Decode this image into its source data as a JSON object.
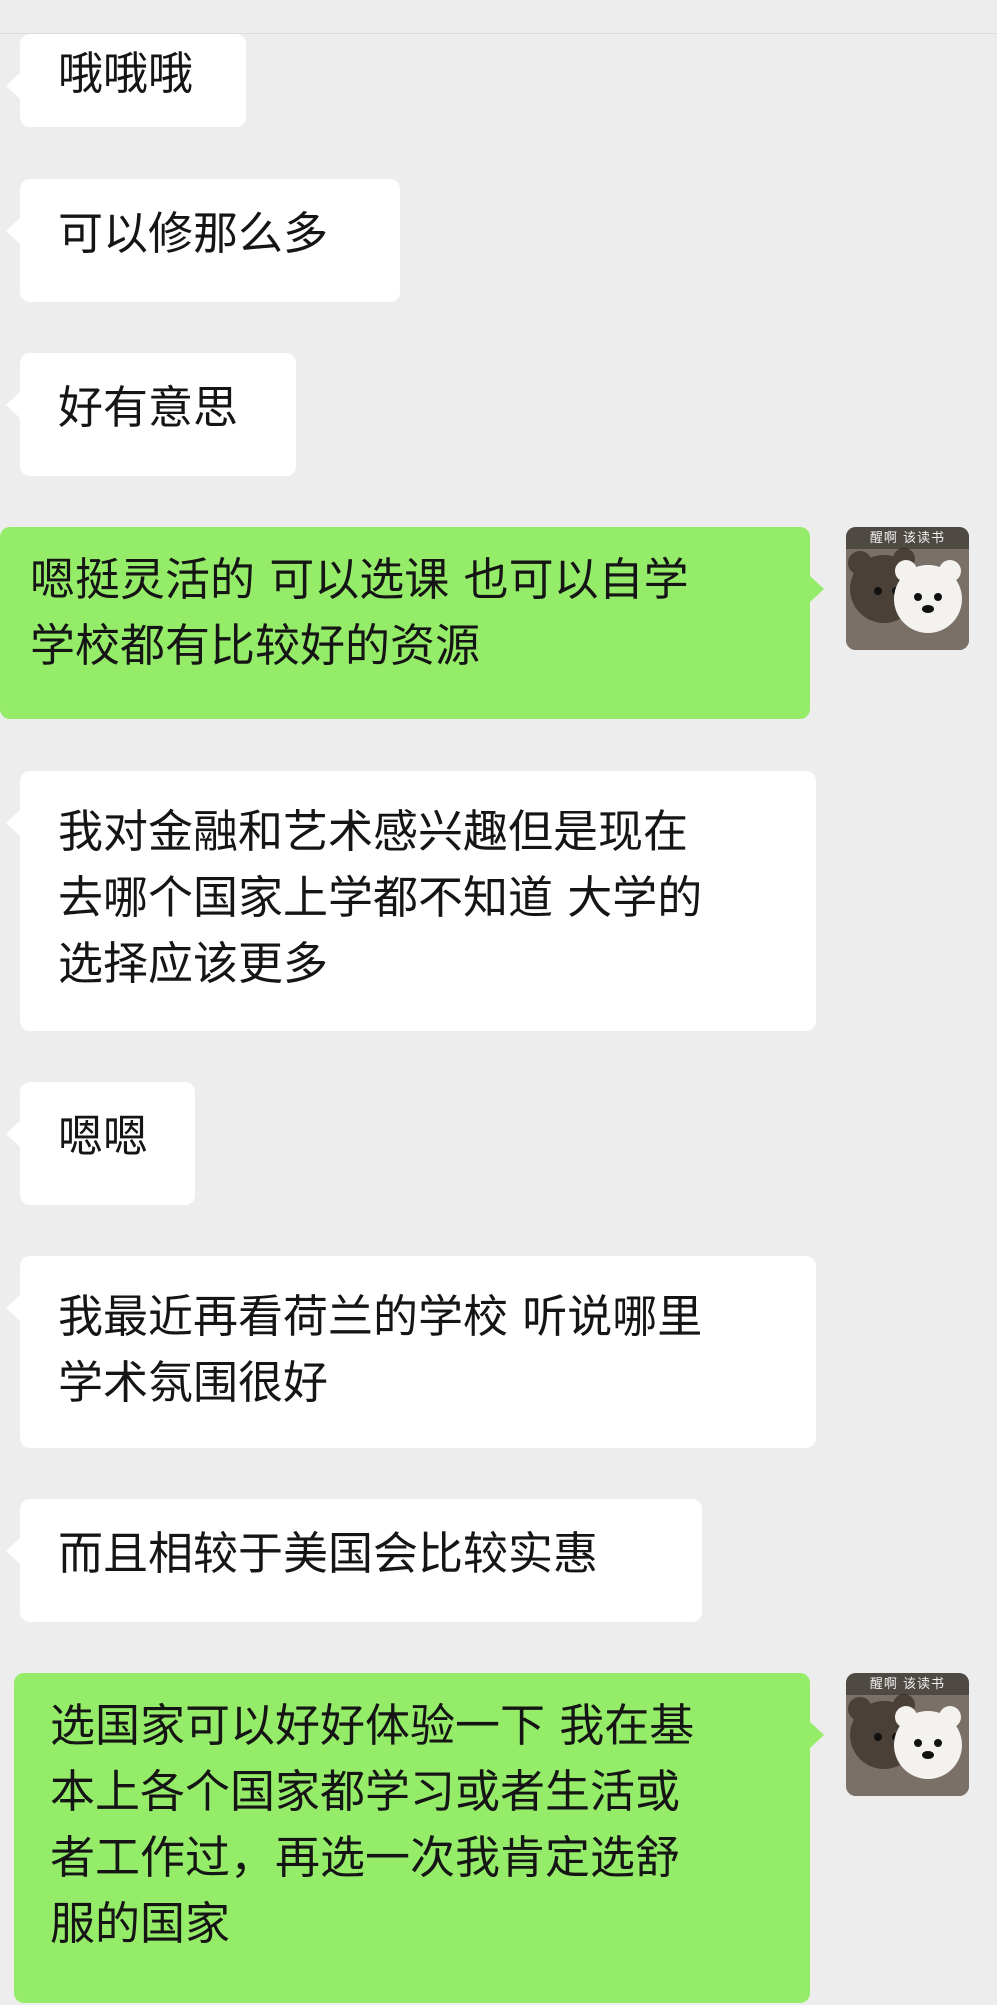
{
  "messages": [
    {
      "side": "in",
      "lines": [
        "哦哦哦"
      ]
    },
    {
      "side": "in",
      "lines": [
        "可以修那么多"
      ]
    },
    {
      "side": "in",
      "lines": [
        "好有意思"
      ]
    },
    {
      "side": "out",
      "lines": [
        "嗯挺灵活的 可以选课 也可以自学",
        "学校都有比较好的资源"
      ]
    },
    {
      "side": "in",
      "lines": [
        "我对金融和艺术感兴趣但是现在",
        "去哪个国家上学都不知道 大学的",
        "选择应该更多"
      ]
    },
    {
      "side": "in",
      "lines": [
        "嗯嗯"
      ]
    },
    {
      "side": "in",
      "lines": [
        "我最近再看荷兰的学校 听说哪里",
        "学术氛围很好"
      ]
    },
    {
      "side": "in",
      "lines": [
        "而且相较于美国会比较实惠"
      ]
    },
    {
      "side": "out",
      "lines": [
        "选国家可以好好体验一下 我在基",
        "本上各个国家都学习或者生活或",
        "者工作过，再选一次我肯定选舒",
        "服的国家"
      ]
    }
  ],
  "avatar": {
    "caption": "醒啊 该读书",
    "icon": "two-plush-bears-avatar"
  },
  "colors": {
    "background": "#ededed",
    "incoming": "#ffffff",
    "outgoing": "#95ec69"
  }
}
